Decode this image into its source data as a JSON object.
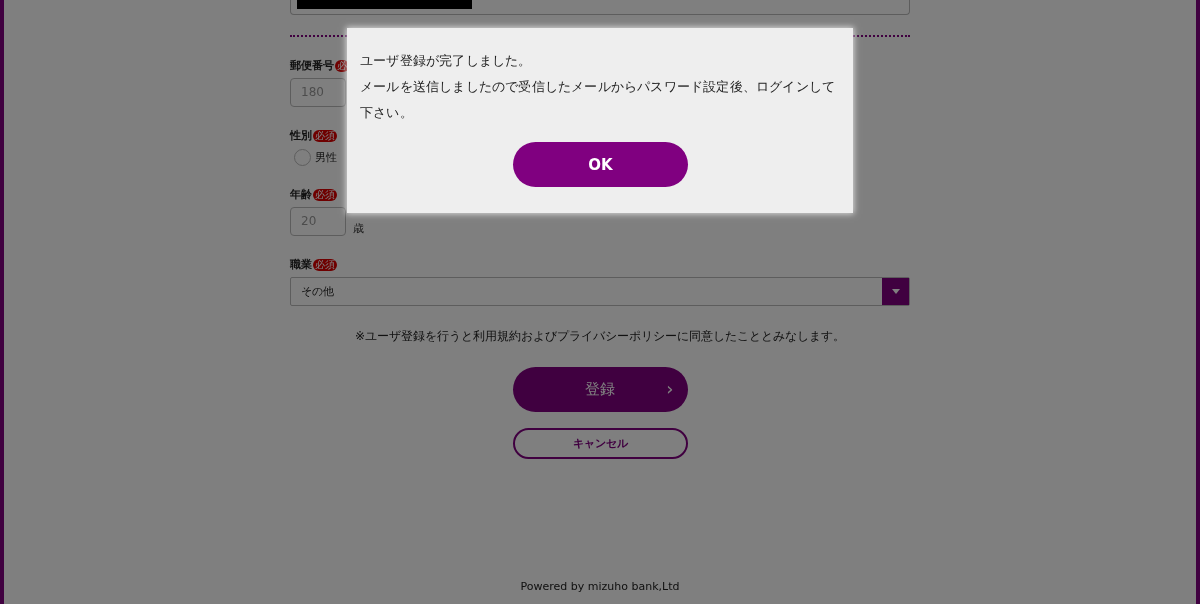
{
  "form": {
    "fields": [
      {
        "kind": "text",
        "label": "郵便番号",
        "required_badge": "必",
        "placeholder": "180"
      },
      {
        "kind": "radio",
        "label": "性別",
        "required_badge": "必須",
        "options": [
          {
            "label": "男性",
            "selected": false
          }
        ]
      },
      {
        "kind": "text",
        "label": "年齢",
        "required_badge": "必須",
        "placeholder": "20",
        "unit": "歳"
      },
      {
        "kind": "select",
        "label": "職業",
        "required_badge": "必須",
        "value": "その他"
      }
    ],
    "notice": "※ユーザ登録を行うと利用規約およびプライバシーポリシーに同意したこととみなします。",
    "submit_button": "登録",
    "submit_arrow": "›",
    "cancel_button": "キャンセル"
  },
  "footer": "Powered by mizuho bank,Ltd",
  "dialog": {
    "messages": [
      "ユーザ登録が完了しました。",
      "メールを送信しましたので受信したメールからパスワード設定後、ログインして下さい。"
    ],
    "ok_button": "OK"
  }
}
